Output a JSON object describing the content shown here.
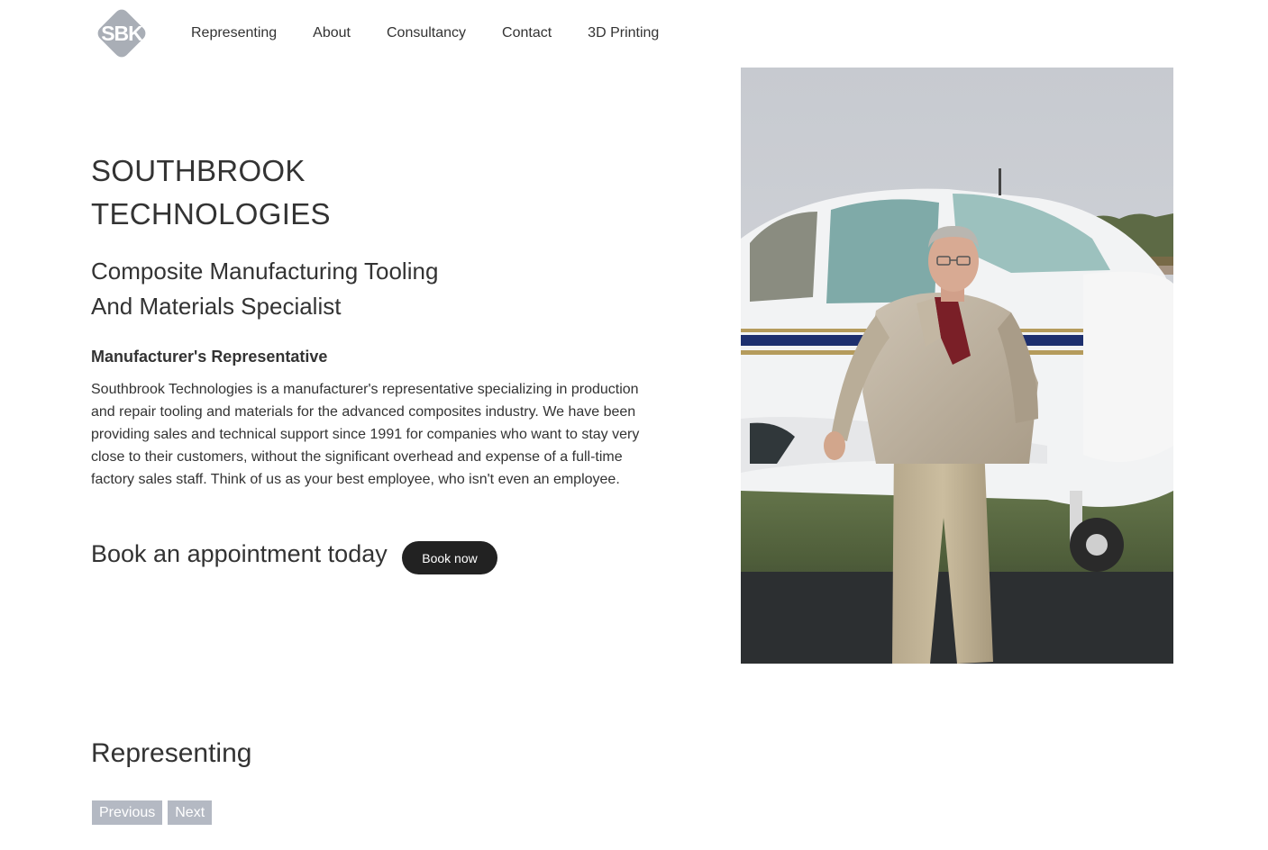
{
  "header": {
    "logo_text": "SBK",
    "nav": [
      {
        "label": "Representing"
      },
      {
        "label": "About"
      },
      {
        "label": "Consultancy"
      },
      {
        "label": "Contact"
      },
      {
        "label": "3D Printing"
      }
    ]
  },
  "hero": {
    "title_line1": "SOUTHBROOK",
    "title_line2": "TECHNOLOGIES",
    "subtitle_line1": "Composite Manufacturing Tooling",
    "subtitle_line2": "And Materials Specialist",
    "label": "Manufacturer's Representative",
    "body": "Southbrook Technologies is a manufacturer's representative specializing in production and repair tooling and materials for the advanced composites industry. We have been providing sales and technical support since 1991 for companies who want to stay very close to their customers, without the significant overhead and expense of a full-time factory sales staff. Think of us as your best employee, who isn't even an employee.",
    "cta_text": "Book an appointment today",
    "cta_button": "Book now"
  },
  "representing": {
    "title": "Representing",
    "prev_label": "Previous",
    "next_label": "Next"
  },
  "colors": {
    "text": "#333333",
    "button_dark": "#222222",
    "pager_button": "#b4b9c3",
    "logo_gray": "#a9aeb6"
  }
}
